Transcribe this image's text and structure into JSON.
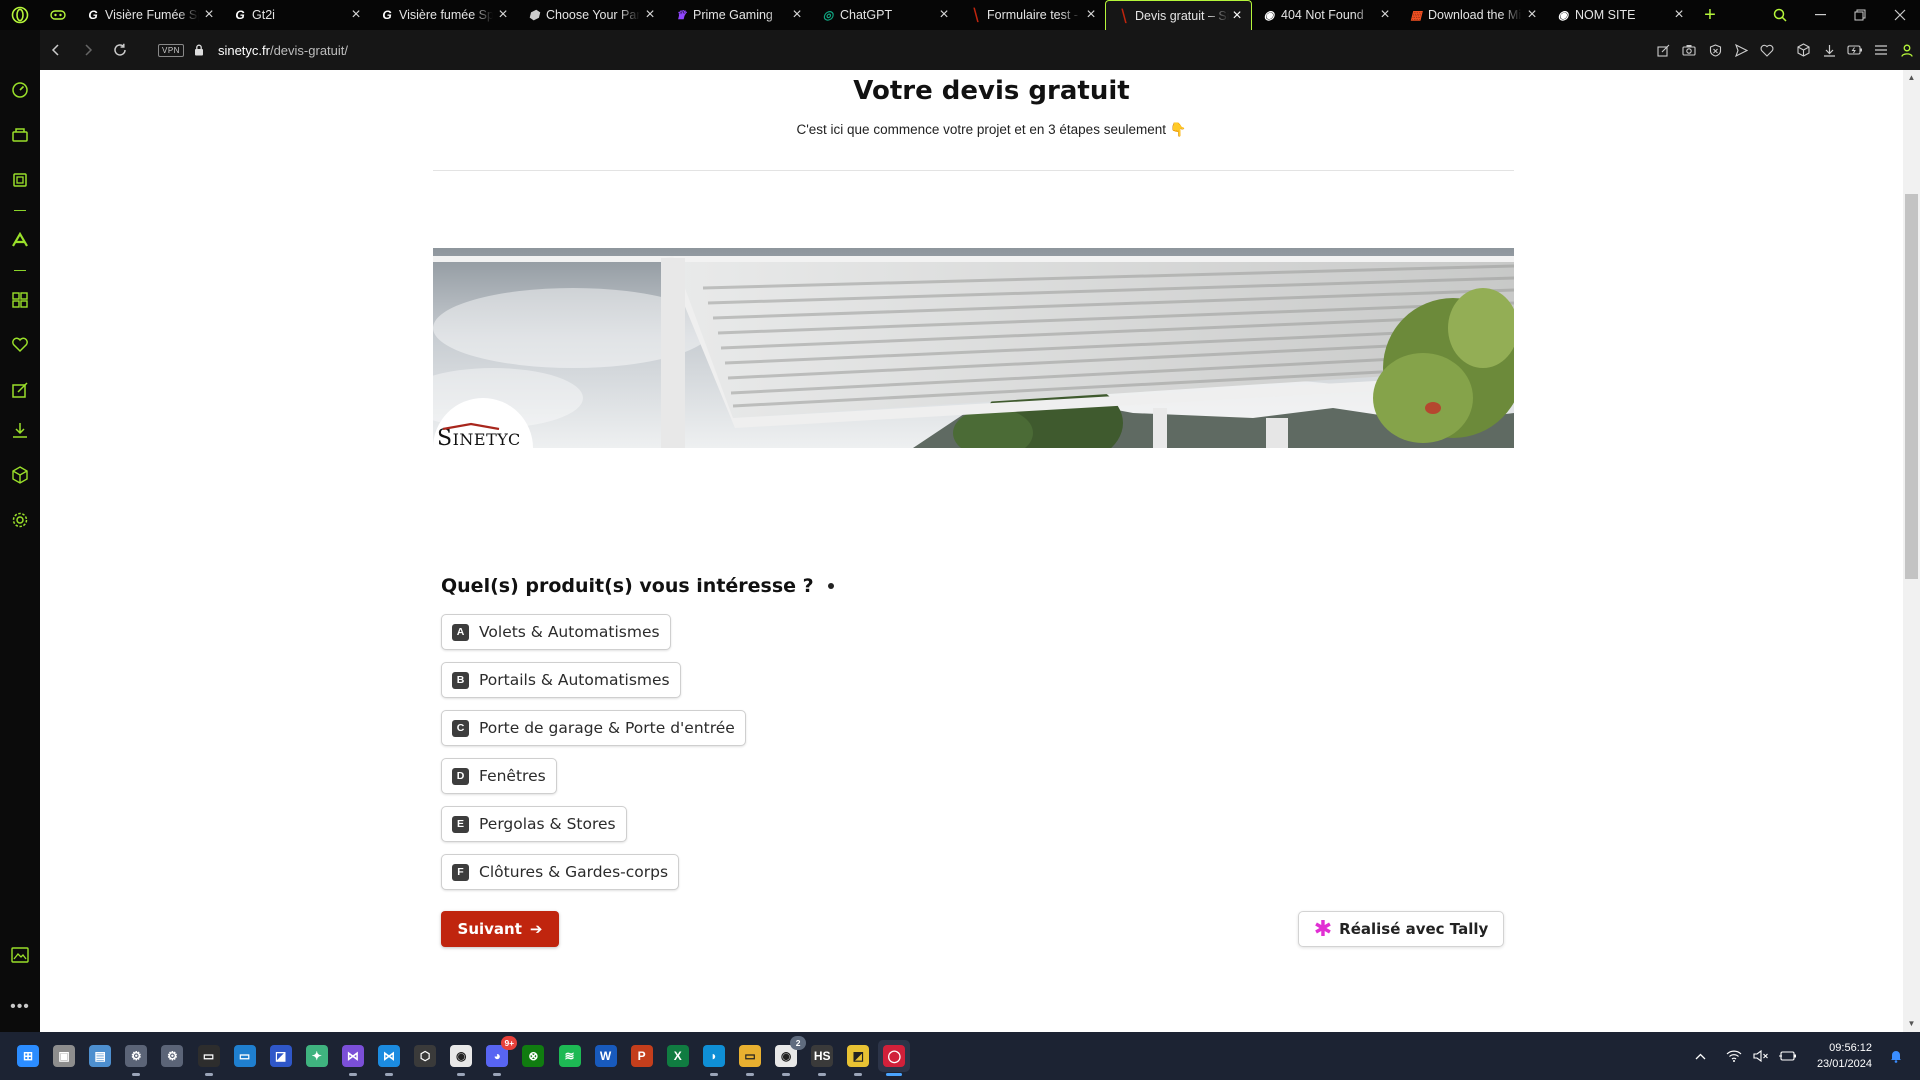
{
  "browser": {
    "tabs": [
      {
        "title": "Visière Fumée Sp",
        "favicon": "G",
        "active": false
      },
      {
        "title": "Gt2i",
        "favicon": "G",
        "active": false
      },
      {
        "title": "Visière fumée Sp",
        "favicon": "G",
        "active": false
      },
      {
        "title": "Choose Your Part",
        "favicon": "⬢",
        "active": false
      },
      {
        "title": "Prime Gaming",
        "favicon": "♛",
        "active": false
      },
      {
        "title": "ChatGPT",
        "favicon": "◎",
        "active": false
      },
      {
        "title": "Formulaire test -",
        "favicon": "╲",
        "active": false
      },
      {
        "title": "Devis gratuit – Si",
        "favicon": "╲",
        "active": true
      },
      {
        "title": "404 Not Found",
        "favicon": "◉",
        "active": false
      },
      {
        "title": "Download the Mi",
        "favicon": "▦",
        "active": false
      },
      {
        "title": "NOM SITE",
        "favicon": "◉",
        "active": false
      }
    ],
    "address": {
      "vpn": "VPN",
      "domain": "sinetyc.fr",
      "path": "/devis-gratuit/"
    },
    "accent": "#b5f53a"
  },
  "page": {
    "title": "Votre devis gratuit",
    "subtitle": "C'est ici que commence votre projet et en 3 étapes seulement 👇",
    "logo": {
      "initial": "S",
      "rest": "INETYC"
    },
    "question": "Quel(s) produit(s) vous intéresse ?",
    "options": [
      {
        "key": "A",
        "label": "Volets & Automatismes"
      },
      {
        "key": "B",
        "label": "Portails & Automatismes"
      },
      {
        "key": "C",
        "label": "Porte de garage & Porte d'entrée"
      },
      {
        "key": "D",
        "label": "Fenêtres"
      },
      {
        "key": "E",
        "label": "Pergolas & Stores"
      },
      {
        "key": "F",
        "label": "Clôtures & Gardes-corps"
      }
    ],
    "next_button": "Suivant",
    "tally_badge": "Réalisé avec Tally",
    "button_color": "#c0250e"
  },
  "taskbar": {
    "badge_count": "9+",
    "badge_count_2": "2",
    "icons": [
      "windows-start",
      "task-view",
      "photos",
      "settings-gear",
      "settings",
      "terminal",
      "desktop",
      "app-generic",
      "app-green",
      "visual-studio",
      "vscode",
      "unity",
      "chrome",
      "discord",
      "xbox",
      "spotify",
      "word",
      "powerpoint",
      "excel",
      "edge",
      "file-explorer",
      "chrome-profile",
      "hubspot",
      "app-yellow",
      "opera-gx"
    ],
    "time": "09:56:12",
    "date": "23/01/2024"
  }
}
